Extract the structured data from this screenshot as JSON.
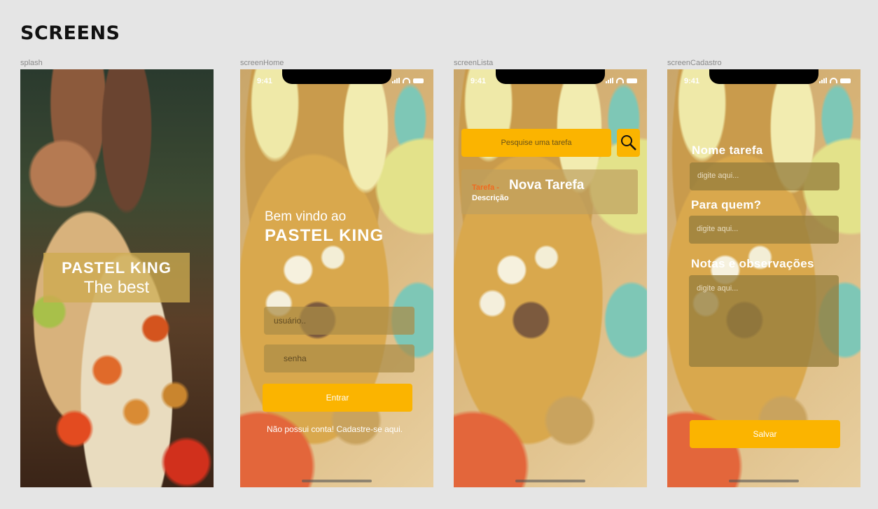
{
  "page": {
    "heading": "SCREENS"
  },
  "splash": {
    "frame_label": "splash",
    "title": "PASTEL KING",
    "subtitle": "The best"
  },
  "home": {
    "frame_label": "screenHome",
    "time": "9:41",
    "welcome_line1": "Bem vindo ao",
    "welcome_line2": "PASTEL KING",
    "username_placeholder": "usuário..",
    "password_placeholder": "senha",
    "login_button": "Entrar",
    "signup_link": "Não possui conta! Cadastre-se aqui."
  },
  "lista": {
    "frame_label": "screenLista",
    "time": "9:41",
    "search_placeholder": "Pesquise uma tarefa",
    "task": {
      "tag": "Tarefa -",
      "title": "Nova Tarefa",
      "description": "Descrição"
    }
  },
  "cadastro": {
    "frame_label": "screenCadastro",
    "time": "9:41",
    "name_label": "Nome tarefa",
    "name_placeholder": "digite aqui...",
    "for_label": "Para quem?",
    "for_placeholder": "digite aqui...",
    "notes_label": "Notas e observações",
    "notes_placeholder": "digite aqui...",
    "save_button": "Salvar"
  },
  "colors": {
    "accent": "#fbb400",
    "tag": "#f06a1f",
    "background": "#e5e5e5"
  },
  "icons": [
    "search-icon",
    "signal-icon",
    "wifi-icon",
    "battery-icon"
  ]
}
